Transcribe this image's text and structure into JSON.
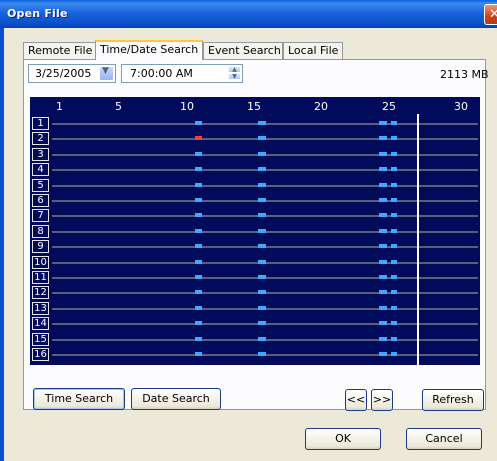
{
  "window": {
    "title": "Open File",
    "close_glyph": "✕"
  },
  "tabs": [
    {
      "label": "Remote File",
      "active": false
    },
    {
      "label": "Time/Date Search",
      "active": true
    },
    {
      "label": "Event Search",
      "active": false
    },
    {
      "label": "Local File",
      "active": false
    }
  ],
  "date_field": {
    "value": "3/25/2005",
    "icon": "chevron-down-icon"
  },
  "time_field": {
    "value": "7:00:00 AM",
    "icon": "spin-icon"
  },
  "storage": {
    "size": "2113 MB"
  },
  "timeline": {
    "column_labels": [
      "1",
      "5",
      "10",
      "15",
      "20",
      "25",
      "30"
    ],
    "rows": [
      "1",
      "2",
      "3",
      "4",
      "5",
      "6",
      "7",
      "8",
      "9",
      "10",
      "11",
      "12",
      "13",
      "14",
      "15",
      "16"
    ],
    "cursor_day": 25,
    "colors": {
      "background": "#020a5c",
      "track": "#5a5e78",
      "recording": "#3fa9ff",
      "alarm": "#ff3a3a",
      "cursor": "#ffffff"
    },
    "alarm_row": "2"
  },
  "buttons": {
    "time_search": "Time Search",
    "date_search": "Date Search",
    "prev": "<<",
    "next": ">>",
    "refresh": "Refresh",
    "ok": "OK",
    "cancel": "Cancel"
  }
}
